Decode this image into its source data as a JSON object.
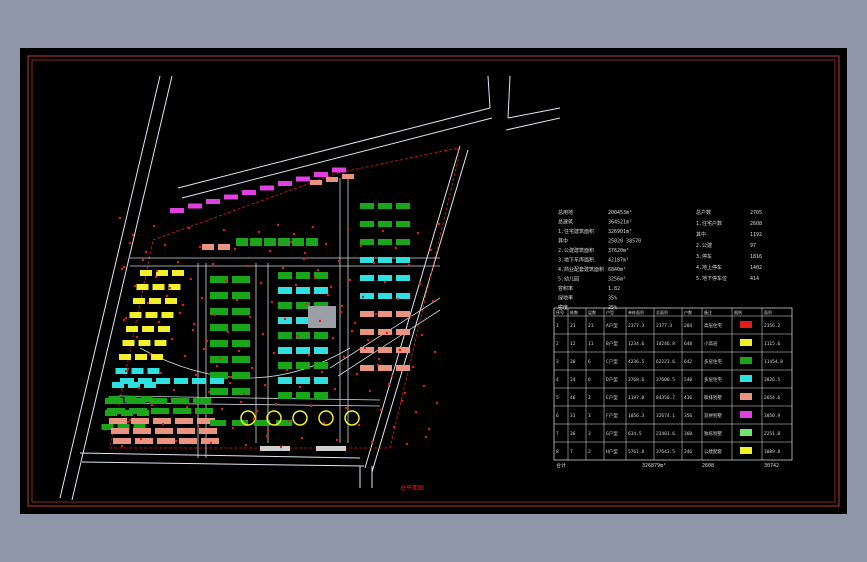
{
  "drawing": {
    "title_label": "总平面图",
    "colors": {
      "frame": "#c0392b",
      "road": "#dfe6ee",
      "green": "#1aa51a",
      "cyan": "#2fe0e0",
      "yellow": "#f2ef2c",
      "magenta": "#e040e0",
      "salmon": "#e89480",
      "red": "#e21c1c",
      "text": "#d8d8d8"
    }
  },
  "summary": {
    "left": [
      {
        "label": "总用地",
        "value": "200453m²"
      },
      {
        "label": "总建筑",
        "value": "364521m²"
      },
      {
        "label": "1.住宅建筑面积",
        "value": "326901m²"
      },
      {
        "label": "其中",
        "value": "25020 38570"
      },
      {
        "label": "2.公建建筑面积",
        "value": "37620m²"
      },
      {
        "label": "3.地下车库面积",
        "value": "42187m²"
      },
      {
        "label": "4.商业配套建筑面积",
        "value": "6840m²"
      },
      {
        "label": "5.幼儿园",
        "value": "3256m²"
      },
      {
        "label": "容积率",
        "value": "1.82"
      },
      {
        "label": "绿地率",
        "value": "35%"
      },
      {
        "label": "密度",
        "value": "25%"
      }
    ],
    "right": [
      {
        "label": "总户数",
        "value": "2705"
      },
      {
        "label": "1.住宅户数",
        "value": "2608"
      },
      {
        "label": "其中",
        "value": "1192"
      },
      {
        "label": "2.公建",
        "value": "97"
      },
      {
        "label": "3.停车",
        "value": "1816"
      },
      {
        "label": "4.地上停车",
        "value": "1402"
      },
      {
        "label": "5.地下停车位",
        "value": "414"
      }
    ]
  },
  "table": {
    "headers": [
      "序号",
      "栋数",
      "层数",
      "户型",
      "单栋面积",
      "总面积",
      "户数",
      "备注",
      "图例",
      "面积"
    ],
    "rows": [
      {
        "no": "1",
        "bld": "21",
        "fl": "21",
        "type": "A户型",
        "unit": "2377.3",
        "total": "2377.3",
        "hh": "204",
        "note": "高层住宅",
        "sw": "#e21c1c",
        "area": "2356.2"
      },
      {
        "no": "2",
        "bld": "12",
        "fl": "11",
        "type": "B户型",
        "unit": "1234.6",
        "total": "14246.8",
        "hh": "648",
        "note": "小高层",
        "sw": "#f2ef2c",
        "area": "1115.6"
      },
      {
        "no": "3",
        "bld": "30",
        "fl": "6",
        "type": "C户型",
        "unit": "4236.5",
        "total": "62223.6",
        "hh": "642",
        "note": "多层住宅",
        "sw": "#1aa51a",
        "area": "11454.8"
      },
      {
        "no": "4",
        "bld": "24",
        "fl": "6",
        "type": "D户型",
        "unit": "3768.6",
        "total": "37600.5",
        "hh": "540",
        "note": "多层住宅",
        "sw": "#2fe0e0",
        "area": "3826.5"
      },
      {
        "no": "5",
        "bld": "46",
        "fl": "3",
        "type": "E户型",
        "unit": "1197.0",
        "total": "84356.7",
        "hh": "436",
        "note": "联排别墅",
        "sw": "#e89480",
        "area": "2654.6"
      },
      {
        "no": "6",
        "bld": "31",
        "fl": "3",
        "type": "F户型",
        "unit": "1056.3",
        "total": "32674.1",
        "hh": "356",
        "note": "双拼别墅",
        "sw": "#e040e0",
        "area": "3050.9"
      },
      {
        "no": "7",
        "bld": "36",
        "fl": "3",
        "type": "G户型",
        "unit": "634.5",
        "total": "23481.6",
        "hh": "360",
        "note": "独栋别墅",
        "sw": "#6ee86e",
        "area": "2251.8"
      },
      {
        "no": "8",
        "bld": "7",
        "fl": "2",
        "type": "H户型",
        "unit": "5761.8",
        "total": "37643.5",
        "hh": "246",
        "note": "公建配套",
        "sw": "#f2ef2c",
        "area": "3089.8"
      }
    ],
    "totals": {
      "label": "合计",
      "total": "326879m²",
      "hh": "2608",
      "area": "30742"
    }
  }
}
